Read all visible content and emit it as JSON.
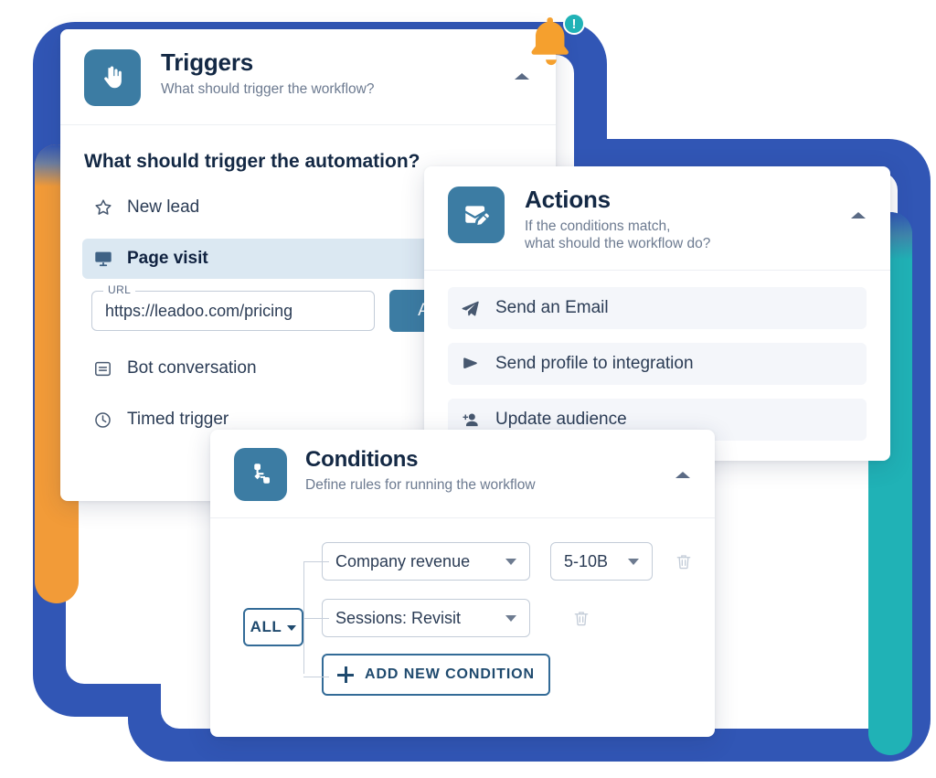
{
  "colors": {
    "frame_blue": "#3156b5",
    "bar_orange": "#f29b38",
    "bar_teal": "#20b2b6",
    "card_icon_blue": "#3c7ca3",
    "selected_row_blue": "#dbe8f2",
    "action_row_gray": "#f4f6fa",
    "outline_blue": "#336b97",
    "title_navy": "#132844"
  },
  "notification": {
    "icon": "bell-icon",
    "badge_icon": "exclamation-icon",
    "badge_text": "!"
  },
  "triggers": {
    "icon": "pointer-hand-icon",
    "title": "Triggers",
    "subtitle": "What should trigger the workflow?",
    "collapse_icon": "chevron-up-icon",
    "question": "What should trigger the automation?",
    "items": [
      {
        "label": "New lead",
        "icon": "star-icon",
        "selected": false
      },
      {
        "label": "Page visit",
        "icon": "monitor-icon",
        "selected": true
      },
      {
        "label": "Bot conversation",
        "icon": "chat-box-icon",
        "selected": false
      },
      {
        "label": "Timed trigger",
        "icon": "clock-icon",
        "selected": false
      }
    ],
    "url_field": {
      "label": "URL",
      "value": "https://leadoo.com/pricing",
      "placeholder": "https://"
    },
    "add_button_label": "Add"
  },
  "actions": {
    "icon": "envelope-pencil-icon",
    "title": "Actions",
    "subtitle": "If the conditions match,\nwhat should the workflow do?",
    "collapse_icon": "chevron-up-icon",
    "items": [
      {
        "label": "Send an Email",
        "icon": "paper-plane-icon"
      },
      {
        "label": "Send profile to integration",
        "icon": "send-flag-icon"
      },
      {
        "label": "Update audience",
        "icon": "person-add-icon"
      }
    ]
  },
  "conditions": {
    "icon": "node-branch-icon",
    "title": "Conditions",
    "subtitle": "Define rules for running the workflow",
    "collapse_icon": "chevron-up-icon",
    "match_selector": {
      "label": "ALL",
      "chevron_icon": "chevron-down-icon"
    },
    "rows": [
      {
        "field": "Company revenue",
        "value": "5-10B",
        "has_value": true,
        "delete_icon": "trash-icon",
        "caret_icon": "caret-down-icon"
      },
      {
        "field": "Sessions: Revisit",
        "value": "",
        "has_value": false,
        "delete_icon": "trash-icon",
        "caret_icon": "caret-down-icon"
      }
    ],
    "add_button": {
      "label": "ADD NEW CONDITION",
      "icon": "plus-icon"
    }
  }
}
